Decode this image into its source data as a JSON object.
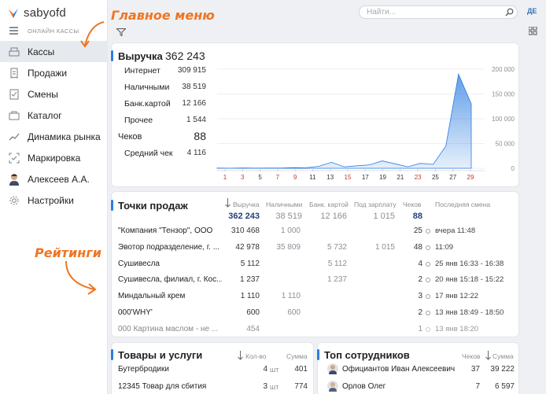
{
  "app": {
    "logo": "sabyofd",
    "search_placeholder": "Найти...",
    "lang": "ДЕ"
  },
  "sidebar": {
    "caption": "ОНЛАЙН КАССЫ",
    "items": [
      {
        "label": "Кассы",
        "icon": "cash-register-icon"
      },
      {
        "label": "Продажи",
        "icon": "receipt-icon"
      },
      {
        "label": "Смены",
        "icon": "shift-icon"
      },
      {
        "label": "Каталог",
        "icon": "catalog-icon"
      },
      {
        "label": "Динамика рынка",
        "icon": "trend-icon"
      },
      {
        "label": "Маркировка",
        "icon": "marking-icon"
      },
      {
        "label": "Алексеев А.А.",
        "icon": "avatar"
      },
      {
        "label": "Настройки",
        "icon": "gear-icon"
      }
    ]
  },
  "annotations": {
    "main_menu": "Главное меню",
    "ratings": "Рейтинги"
  },
  "revenue": {
    "title": "Выручка",
    "total": "362 243",
    "rows": [
      {
        "label": "Интернет",
        "value": "309 915"
      },
      {
        "label": "Наличными",
        "value": "38 519"
      },
      {
        "label": "Банк.картой",
        "value": "12 166"
      },
      {
        "label": "Прочее",
        "value": "1 544"
      }
    ],
    "checks_label": "Чеков",
    "checks_value": "88",
    "avg_label": "Средний чек",
    "avg_value": "4 116"
  },
  "chart_data": {
    "type": "area",
    "x": [
      "1",
      "3",
      "5",
      "7",
      "9",
      "11",
      "13",
      "15",
      "17",
      "19",
      "21",
      "23",
      "25",
      "27",
      "29"
    ],
    "x_ticks": [
      {
        "label": "1",
        "color": "#c0392b"
      },
      {
        "label": "3",
        "color": "#c0392b"
      },
      {
        "label": "5",
        "color": "#333"
      },
      {
        "label": "7",
        "color": "#c0392b"
      },
      {
        "label": "9",
        "color": "#c0392b"
      },
      {
        "label": "11",
        "color": "#333"
      },
      {
        "label": "13",
        "color": "#333"
      },
      {
        "label": "15",
        "color": "#c0392b"
      },
      {
        "label": "17",
        "color": "#333"
      },
      {
        "label": "19",
        "color": "#333"
      },
      {
        "label": "21",
        "color": "#333"
      },
      {
        "label": "23",
        "color": "#c0392b"
      },
      {
        "label": "25",
        "color": "#333"
      },
      {
        "label": "27",
        "color": "#333"
      },
      {
        "label": "29",
        "color": "#c0392b"
      }
    ],
    "values": [
      400,
      200,
      800,
      300,
      600,
      500,
      1500,
      900,
      4000,
      12000,
      3000,
      5000,
      7000,
      15000,
      9000,
      3000,
      10000,
      8000,
      45000,
      190000,
      130000
    ],
    "y_ticks": [
      "200 000",
      "150 000",
      "100 000",
      "50 000",
      "0"
    ],
    "ylim": [
      0,
      200000
    ],
    "grid": true,
    "color": "#2b7de0"
  },
  "points": {
    "title": "Точки продаж",
    "columns": [
      "Выручка",
      "Наличными",
      "Банк. картой",
      "Под зарплату",
      "Чеков",
      "Последняя смена"
    ],
    "totals": {
      "revenue": "362 243",
      "cash": "38 519",
      "card": "12 166",
      "salary": "1 015",
      "checks": "88"
    },
    "rows": [
      {
        "name": "\"Компания \"Тензор\", ООО",
        "revenue": "310 468",
        "cash": "1 000",
        "card": "",
        "salary": "",
        "checks": "25",
        "shift": "вчера 11:48"
      },
      {
        "name": "Эвотор подразделение, г. ...",
        "revenue": "42 978",
        "cash": "35 809",
        "card": "5 732",
        "salary": "1 015",
        "checks": "48",
        "shift": "11:09"
      },
      {
        "name": "Сушивесла",
        "revenue": "5 112",
        "cash": "",
        "card": "5 112",
        "salary": "",
        "checks": "4",
        "shift": "25 янв 16:33 - 16:38"
      },
      {
        "name": "Сушивесла, филиал, г. Кос...",
        "revenue": "1 237",
        "cash": "",
        "card": "1 237",
        "salary": "",
        "checks": "2",
        "shift": "20 янв 15:18 - 15:22"
      },
      {
        "name": "Миндальный крем",
        "revenue": "1 110",
        "cash": "1 110",
        "card": "",
        "salary": "",
        "checks": "3",
        "shift": "17 янв 12:22"
      },
      {
        "name": "000'WHY'",
        "revenue": "600",
        "cash": "600",
        "card": "",
        "salary": "",
        "checks": "2",
        "shift": "13 янв 18:49 - 18:50"
      },
      {
        "name": "000 Картина маслом - не ...",
        "revenue": "454",
        "cash": "",
        "card": "",
        "salary": "",
        "checks": "1",
        "shift": "13 янв 18:20"
      }
    ]
  },
  "goods": {
    "title": "Товары и услуги",
    "qty_label": "Кол-во",
    "sum_label": "Сумма",
    "rows": [
      {
        "name": "Бутербродики",
        "qty": "4",
        "unit": "шт",
        "sum": "401"
      },
      {
        "name": "12345 Товар для сбития",
        "qty": "3",
        "unit": "шт",
        "sum": "774"
      }
    ]
  },
  "staff": {
    "title": "Топ сотрудников",
    "checks_label": "Чеков",
    "sum_label": "Сумма",
    "rows": [
      {
        "name": "Официантов Иван Алексеевич",
        "checks": "37",
        "sum": "39 222"
      },
      {
        "name": "Орлов Олег",
        "checks": "7",
        "sum": "6 597"
      }
    ]
  }
}
